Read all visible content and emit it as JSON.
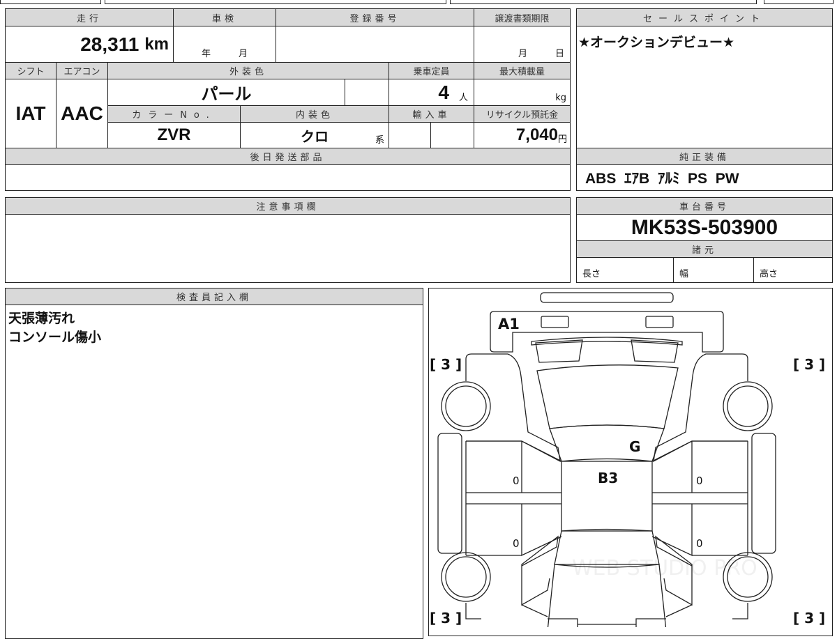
{
  "mileage": {
    "label": "走行",
    "value": "28,311",
    "unit": "km"
  },
  "inspection": {
    "label": "車検",
    "year_unit": "年",
    "month_unit": "月"
  },
  "registration": {
    "label": "登録番号",
    "value": ""
  },
  "transfer_deadline": {
    "label": "譲渡書類期限",
    "month_unit": "月",
    "day_unit": "日"
  },
  "shift": {
    "label": "シフト",
    "value": "IAT"
  },
  "aircon": {
    "label": "エアコン",
    "value": "AAC"
  },
  "exterior_color": {
    "label": "外装色",
    "value": "パール"
  },
  "capacity": {
    "label": "乗車定員",
    "value": "4",
    "unit": "人"
  },
  "max_load": {
    "label": "最大積載量",
    "unit": "kg"
  },
  "color_no": {
    "label": "カラーNo.",
    "value": "ZVR"
  },
  "interior_color": {
    "label": "内装色",
    "value": "クロ",
    "unit": "系"
  },
  "imported": {
    "label": "輸入車"
  },
  "recycle": {
    "label": "リサイクル預託金",
    "value": "7,040",
    "unit": "円"
  },
  "later_parts": {
    "label": "後日発送部品"
  },
  "sales_point": {
    "label": "セールスポイント",
    "value": "★オークションデビュー★"
  },
  "equipment": {
    "label": "純正装備",
    "value": "ABS  ｴｱB  ｱﾙﾐ  PS  PW"
  },
  "notes": {
    "label": "注意事項欄"
  },
  "chassis": {
    "label": "車台番号",
    "value": "MK53S-503900"
  },
  "specs": {
    "label": "諸元",
    "length": "長さ",
    "width": "幅",
    "height": "高さ"
  },
  "inspector": {
    "label": "検査員記入欄",
    "lines": [
      "天張薄汚れ",
      "コンソール傷小"
    ]
  },
  "diagram": {
    "marks": {
      "front_bumper": "A1",
      "roof_front": "G",
      "roof": "B3",
      "door_fl": "0",
      "door_rl": "0",
      "door_fr": "0",
      "door_rr": "0"
    },
    "tire": "[ 3 ]",
    "watermark": "WEB STUDIO PRO"
  }
}
